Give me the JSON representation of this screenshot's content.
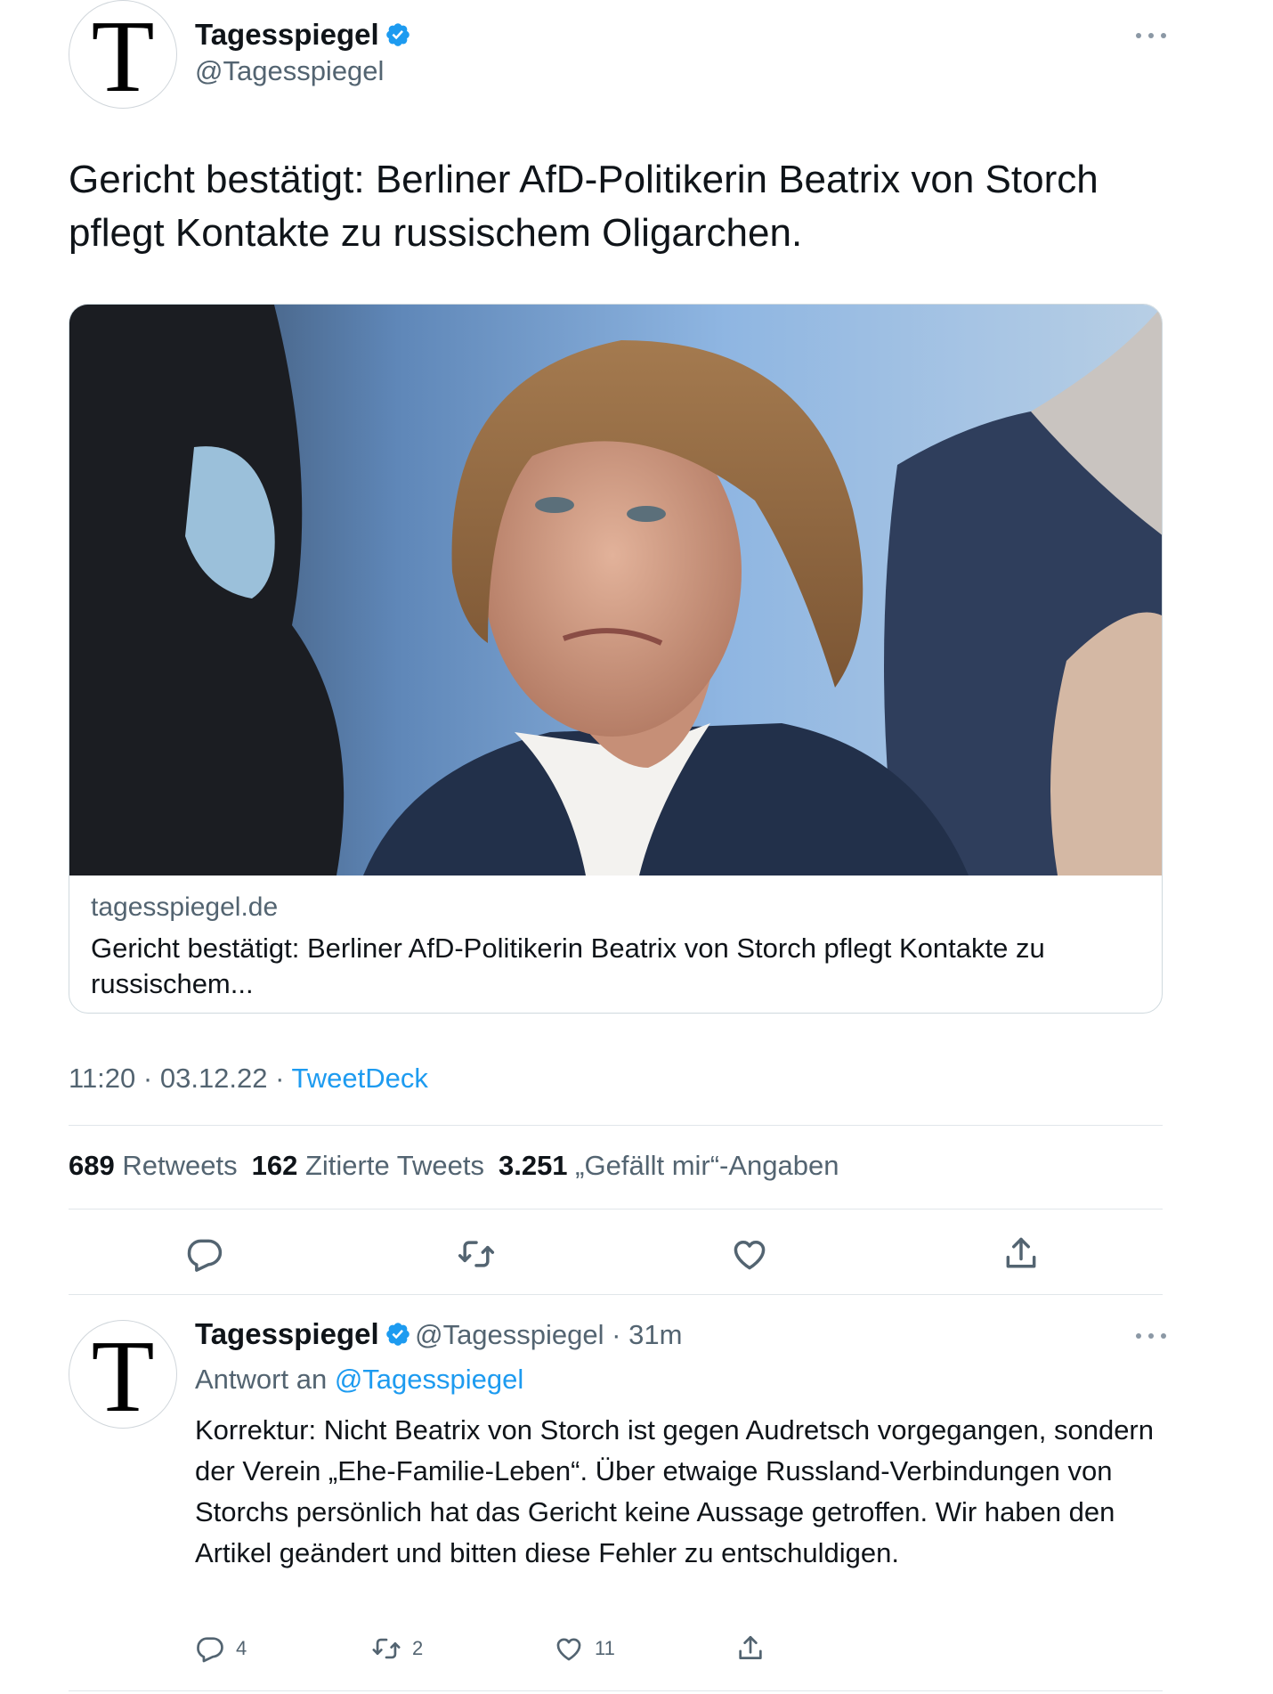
{
  "main_tweet": {
    "avatar_letter": "T",
    "name": "Tagesspiegel",
    "handle": "@Tagesspiegel",
    "text": "Gericht bestätigt: Berliner AfD-Politikerin Beatrix von Storch pflegt Kontakte zu russischem Oligarchen.",
    "card": {
      "domain": "tagesspiegel.de",
      "title": "Gericht bestätigt: Berliner AfD-Politikerin Beatrix von Storch pflegt Kontakte zu russischem..."
    },
    "time": "11:20",
    "date": "03.12.22",
    "source": "TweetDeck",
    "stats": {
      "retweets_count": "689",
      "retweets_label": "Retweets",
      "quotes_count": "162",
      "quotes_label": "Zitierte Tweets",
      "likes_count": "3.251",
      "likes_label": "„Gefällt mir“-Angaben"
    }
  },
  "reply_tweet": {
    "avatar_letter": "T",
    "name": "Tagesspiegel",
    "handle": "@Tagesspiegel",
    "time_ago": "31m",
    "reply_prefix": "Antwort an",
    "reply_mention": "@Tagesspiegel",
    "text": "Korrektur: Nicht Beatrix von Storch ist gegen Audretsch vorgegangen, sondern der Verein „Ehe-Familie-Leben“. Über etwaige Russland-Verbindungen von Storchs persönlich hat das Gericht keine Aussage getroffen. Wir haben den Artikel geändert und bitten diese Fehler zu entschuldigen.",
    "reply_count": "4",
    "retweet_count": "2",
    "like_count": "11"
  },
  "colors": {
    "accent": "#1d9bf0",
    "text": "#0f1419",
    "muted": "#536471",
    "border": "#cfd9de"
  },
  "icons": {
    "verified": "verified-badge-icon",
    "more": "more-icon",
    "reply": "reply-icon",
    "retweet": "retweet-icon",
    "like": "heart-icon",
    "share": "share-icon"
  }
}
